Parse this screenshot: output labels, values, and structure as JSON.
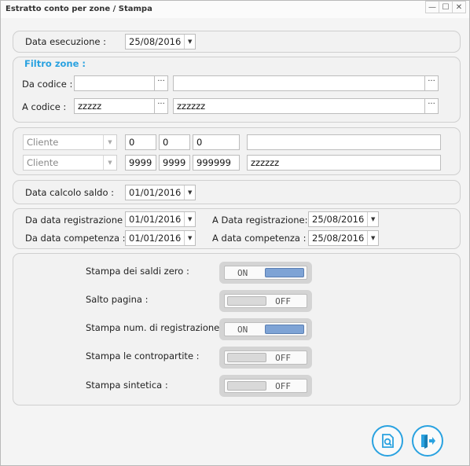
{
  "window": {
    "title": "Estratto conto per zone / Stampa",
    "controls": {
      "minimize": "—",
      "maximize": "☐",
      "close": "✕"
    }
  },
  "execution": {
    "label": "Data esecuzione :",
    "date": "25/08/2016"
  },
  "zone_filter": {
    "title": "Filtro zone :",
    "from": {
      "label": "Da codice :",
      "code": "",
      "description": ""
    },
    "to": {
      "label": "A codice :",
      "code": "zzzzz",
      "description": "zzzzzz"
    },
    "browse_label": "···"
  },
  "client_filter": {
    "from": {
      "type": "Cliente",
      "c1": "0",
      "c2": "0",
      "c3": "0",
      "name": ""
    },
    "to": {
      "type": "Cliente",
      "c1": "9999",
      "c2": "9999",
      "c3": "999999",
      "name": "zzzzzz"
    }
  },
  "balance": {
    "label": "Data calcolo saldo :",
    "date": "01/01/2016"
  },
  "dates": {
    "reg_from_label": "Da data registrazione :",
    "reg_from": "01/01/2016",
    "reg_to_label": "A Data registrazione:",
    "reg_to": "25/08/2016",
    "comp_from_label": "Da data competenza :",
    "comp_from": "01/01/2016",
    "comp_to_label": "A data competenza :",
    "comp_to": "25/08/2016"
  },
  "options": [
    {
      "label": "Stampa dei saldi zero :",
      "state": "ON"
    },
    {
      "label": "Salto pagina :",
      "state": "OFF"
    },
    {
      "label": "Stampa num. di registrazione :",
      "state": "ON"
    },
    {
      "label": "Stampa le contropartite :",
      "state": "OFF"
    },
    {
      "label": "Stampa sintetica :",
      "state": "OFF"
    }
  ],
  "icons": {
    "preview": "print-preview-icon",
    "exit": "exit-door-icon",
    "dropdown": "▼",
    "accent": "#2aa2e0"
  }
}
